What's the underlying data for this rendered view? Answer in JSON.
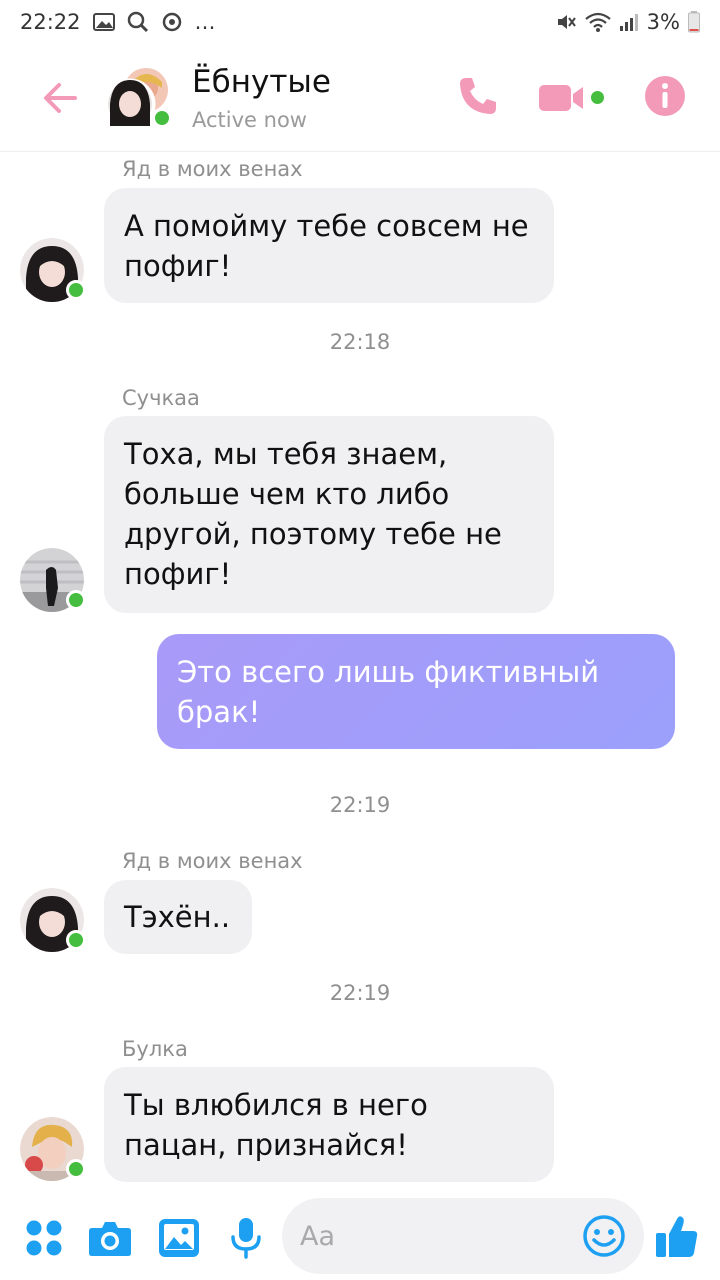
{
  "statusbar": {
    "time": "22:22",
    "dots": "…",
    "battery": "3%"
  },
  "header": {
    "title": "Ёбнутые",
    "status": "Active now"
  },
  "messages": [
    {
      "sender": "Яд в моих венах",
      "lines": [
        "А помойму тебе совсем не",
        "пофиг!"
      ]
    },
    {
      "timestamp": "22:18"
    },
    {
      "sender": "Сучкаа",
      "lines": [
        "Тоха, мы тебя знаем,",
        "больше чем кто либо",
        "другой, поэтому тебе не",
        "пофиг!"
      ]
    },
    {
      "outgoing": true,
      "lines": [
        "Это всего лишь фиктивный",
        "брак!"
      ]
    },
    {
      "timestamp": "22:19"
    },
    {
      "sender": "Яд в моих венах",
      "lines": [
        "Тэхён.."
      ]
    },
    {
      "timestamp": "22:19"
    },
    {
      "sender": "Булка",
      "lines": [
        "Ты влюбился в него",
        "пацан, признайся!"
      ]
    }
  ],
  "composer": {
    "placeholder": "Aa"
  },
  "colors": {
    "accent_pink": "#f49ab9",
    "accent_blue": "#1ea0f2",
    "online_green": "#45bd3f",
    "outgoing_bubble": "#a99af8"
  },
  "icons": [
    "back-arrow-icon",
    "phone-icon",
    "video-icon",
    "info-icon",
    "apps-icon",
    "camera-icon",
    "gallery-icon",
    "microphone-icon",
    "emoji-icon",
    "thumbs-up-icon"
  ]
}
